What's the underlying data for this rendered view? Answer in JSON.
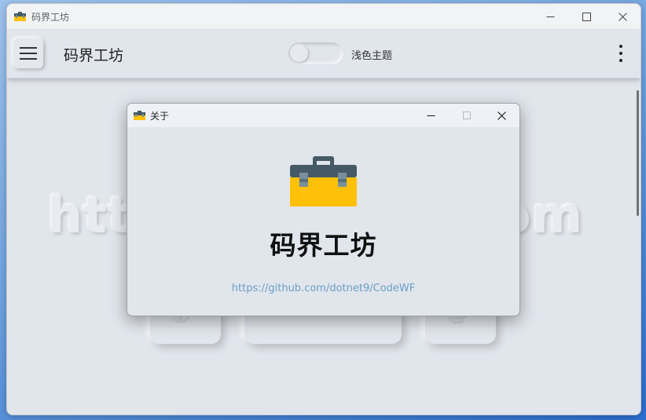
{
  "window": {
    "title": "码界工坊",
    "icon": "toolbox-icon",
    "controls": [
      "minimize-icon",
      "maximize-icon",
      "close-icon"
    ]
  },
  "appbar": {
    "menu_icon": "hamburger-icon",
    "title": "码界工坊",
    "theme_toggle": {
      "label": "浅色主题",
      "on": false
    },
    "more_icon": "more-vertical-icon"
  },
  "background": {
    "left_text": "http",
    "right_text": "om"
  },
  "dialog": {
    "title": "关于",
    "icon": "toolbox-icon",
    "app_name": "码界工坊",
    "link": "https://github.com/dotnet9/CodeWF",
    "controls": [
      "minimize-icon",
      "maximize-icon-disabled",
      "close-icon"
    ]
  },
  "colors": {
    "surface": "#e1e5ec",
    "titlebar": "#f2f3f5",
    "toolbox_body": "#ffc107",
    "toolbox_lid": "#455a64",
    "toolbox_latch": "#78909c",
    "link": "#6a9fc6"
  }
}
